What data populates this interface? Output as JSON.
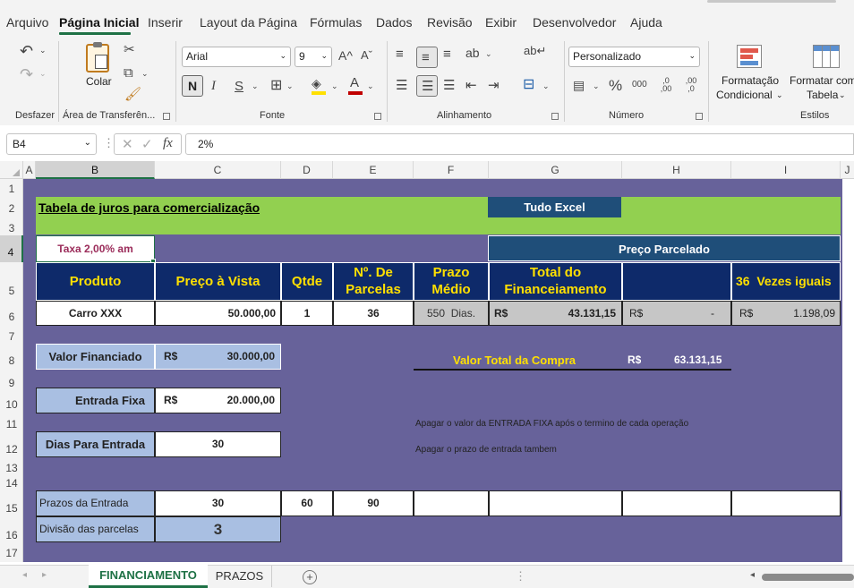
{
  "menu": [
    "Arquivo",
    "Página Inicial",
    "Inserir",
    "Layout da Página",
    "Fórmulas",
    "Dados",
    "Revisão",
    "Exibir",
    "Desenvolvedor",
    "Ajuda"
  ],
  "ribbon": {
    "undo_group": "Desfazer",
    "clipboard": {
      "paste_label": "Colar",
      "group": "Área de Transferên..."
    },
    "font": {
      "name": "Arial",
      "size": "9",
      "group": "Fonte",
      "bold": "N",
      "italic": "I",
      "underline": "S",
      "grow": "A^",
      "shrink": "Aˇ",
      "color": "A"
    },
    "alignment": {
      "group": "Alinhamento"
    },
    "number": {
      "format": "Personalizado",
      "group": "Número",
      "percent": "%",
      "thousands": "000",
      "inc_dec": ",0 ,00",
      "dec_dec": ",00 ,0"
    },
    "styles": {
      "cond_format": [
        "Formatação",
        "Condicional"
      ],
      "format_table": [
        "Formatar como",
        "Tabela"
      ],
      "group": "Estilos"
    }
  },
  "formula_bar": {
    "name_box": "B4",
    "fx": "fx",
    "value": "2%"
  },
  "columns": [
    "A",
    "B",
    "C",
    "D",
    "E",
    "F",
    "G",
    "H",
    "I",
    "J"
  ],
  "rows": [
    "1",
    "2",
    "3",
    "4",
    "5",
    "6",
    "7",
    "8",
    "9",
    "10",
    "11",
    "12",
    "13",
    "14",
    "15",
    "16",
    "17"
  ],
  "sheet": {
    "title": "Tabela de juros para comercialização",
    "brand": "Tudo Excel",
    "rate": "Taxa 2,00% am",
    "installment_header": "Preço Parcelado",
    "headers": {
      "produto": "Produto",
      "preco_vista": "Preço à Vista",
      "qtde": "Qtde",
      "parcelas": "Nº. De Parcelas",
      "prazo": "Prazo Médio",
      "total_fin": "Total do Financeiamento",
      "vezes_num": "36",
      "vezes": "Vezes iguais"
    },
    "row6": {
      "produto": "Carro XXX",
      "preco": "50.000,00",
      "qtde": "1",
      "parcelas": "36",
      "prazo_num": "550",
      "prazo_unit": "Dias.",
      "cur1": "R$",
      "total": "43.131,15",
      "cur2": "R$",
      "dash": "-",
      "cur3": "R$",
      "parcela": "1.198,09"
    },
    "valor_financiado": {
      "label": "Valor Financiado",
      "cur": "R$",
      "value": "30.000,00"
    },
    "entrada_fixa": {
      "label": "Entrada Fixa",
      "cur": "R$",
      "value": "20.000,00"
    },
    "dias_entrada": {
      "label": "Dias Para Entrada",
      "value": "30"
    },
    "valor_total": {
      "label": "Valor Total da Compra",
      "cur": "R$",
      "value": "63.131,15"
    },
    "note1": "Apagar o valor da ENTRADA FIXA após o termino de cada operação",
    "note2": "Apagar o prazo de entrada tambem",
    "prazos_entrada": {
      "label": "Prazos da Entrada",
      "values": [
        "30",
        "60",
        "90"
      ]
    },
    "divisao": {
      "label": "Divisão das parcelas",
      "value": "3"
    }
  },
  "tabs": [
    "FINANCIAMENTO",
    "PRAZOS"
  ],
  "colors": {
    "purple": "#67629a",
    "green": "#92d050",
    "navy": "#0e2a6a",
    "yellow": "#ffe000",
    "accent": "#1e7145"
  }
}
